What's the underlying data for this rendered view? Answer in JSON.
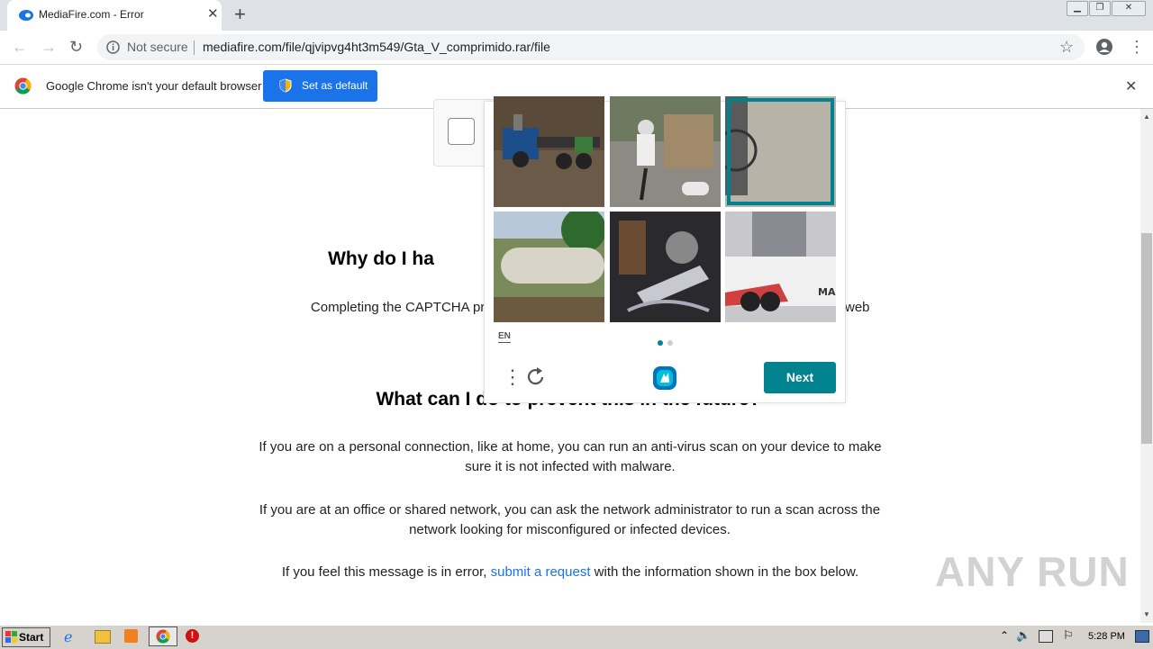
{
  "browser": {
    "tab_title": "MediaFire.com - Error",
    "security_label": "Not secure",
    "url": "mediafire.com/file/qjvipvg4ht3m549/Gta_V_comprimido.rar/file"
  },
  "infobar": {
    "message": "Google Chrome isn't your default browser",
    "button_label": "Set as default",
    "close_glyph": "✕"
  },
  "page": {
    "heading1_partial": "Why do I ha",
    "para1_left": "Completing the CAPTCHA proves",
    "para1_right": "web",
    "heading2_partial": "What can I do to prevent this in the future?",
    "para2": "If you are on a personal connection, like at home, you can run an anti-virus scan on your device to make sure it is not infected with malware.",
    "para3": "If you are at an office or shared network, you can ask the network administrator to run a scan across the network looking for misconfigured or infected devices.",
    "para4_before": "If you feel this message is in error, ",
    "para4_link": "submit a request",
    "para4_after": " with the information shown in the box below."
  },
  "captcha": {
    "language": "EN",
    "next_label": "Next",
    "tiles": [
      {
        "desc": "truck",
        "selected": false
      },
      {
        "desc": "bicycle",
        "selected": true
      },
      {
        "desc": "bicycle",
        "selected": true
      },
      {
        "desc": "tanker",
        "selected": false
      },
      {
        "desc": "bicycle",
        "selected": true
      },
      {
        "desc": "truck",
        "selected": false
      }
    ],
    "page_dots": 2,
    "active_dot": 1,
    "accent_color": "#00838f"
  },
  "watermark": "ANY RUN",
  "taskbar": {
    "start_label": "Start",
    "clock": "5:28 PM"
  }
}
